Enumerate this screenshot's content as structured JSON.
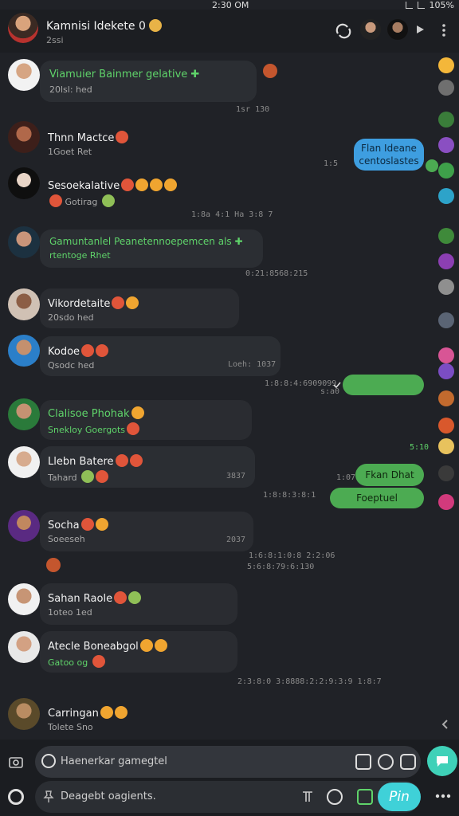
{
  "status": {
    "time": "2:30 OM",
    "battery": "105%"
  },
  "header": {
    "title": "Kamnisi Idekete 0",
    "subtitle": "2ssi"
  },
  "messages": [
    {
      "name": "Viamuier Bainmer gelative",
      "plus": "✚",
      "sub": "20lsl: hed",
      "time": "1sr 130"
    },
    {
      "name": "Thnn Mactce",
      "sub": "1Goet Ret"
    },
    {
      "name": "Sesoekalative",
      "sub": "Gotirag"
    },
    {
      "name": "Gamuntanlel Peanetennoepemcen als",
      "plus": "✚",
      "sub": "rtentoge Rhet",
      "time": "0:21:8568:215"
    },
    {
      "name": "Vikordetaite",
      "sub": "20sdo hed"
    },
    {
      "name": "Kodoe",
      "sub": "Qsodc hed",
      "time": "Loeh: 1037"
    },
    {
      "name": "Clalisoe Phohak",
      "sub": "Snekloy Goergots"
    },
    {
      "name": "Llebn Batere",
      "sub": "Tahard",
      "time": "3837"
    },
    {
      "name": "Socha",
      "sub": "Soeeseh",
      "time": "2037"
    },
    {
      "name": "Sahan Raole",
      "sub": "1oteo 1ed"
    },
    {
      "name": "Atecle Boneabgol",
      "sub": "Gatoo og"
    },
    {
      "name": "Carringan",
      "sub": "Tolete Sno"
    }
  ],
  "outgoing": [
    {
      "text": "Flan Ideane\ncentoslastes",
      "time": "1:5"
    },
    {
      "text": "",
      "time": "1:8:8:4:6909099"
    },
    {
      "text": "Fkan Dhat",
      "time": "1:07"
    },
    {
      "text": "Foeptuel",
      "time": "1:8:8:4:8990:1"
    }
  ],
  "timestamps": {
    "t1": "1:8a 4:1 Ha 3:8 7",
    "t2": "s:a0 ",
    "t3": "1:8:8:4:6909099",
    "t4": "1:8:8:3:8:1",
    "t5": "1:6:8:1:0:8 2:2:06",
    "t6": "5:6:8:79:6:130",
    "t7": "2:3:8:0 3:8888:2:2:9:3:9 1:8:7",
    "t8": "5:10"
  },
  "composer": {
    "placeholder": "Haenerkar gamegtel",
    "placeholder2": "Deagebt oagients.",
    "pin_label": "Pin"
  },
  "colors": {
    "accent_green": "#4cab52",
    "accent_blue": "#3e9ee0",
    "accent_teal": "#3fd1d8"
  }
}
